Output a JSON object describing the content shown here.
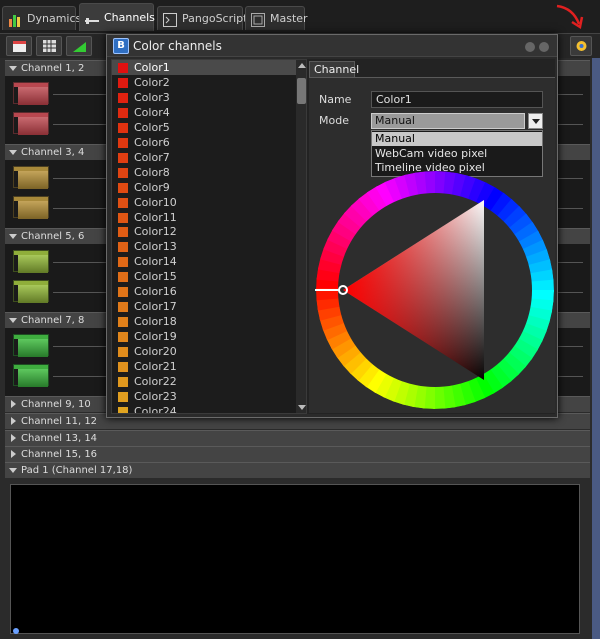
{
  "tabs": [
    {
      "label": "Dynamics",
      "icon": "bar-chart-icon"
    },
    {
      "label": "Channels",
      "icon": "channels-icon"
    },
    {
      "label": "PangoScript",
      "icon": "script-icon"
    },
    {
      "label": "Master",
      "icon": "master-icon"
    }
  ],
  "toolbar": {
    "buttons": [
      "calendar-icon",
      "table-icon",
      "ramp-icon"
    ],
    "settings_icon": "flower-settings-icon"
  },
  "channel_groups": [
    {
      "label": "Channel 1, 2",
      "expanded": true,
      "color": "#b8474f"
    },
    {
      "label": "Channel 3, 4",
      "expanded": true,
      "color": "#a8893a"
    },
    {
      "label": "Channel 5, 6",
      "expanded": true,
      "color": "#8fae3a"
    },
    {
      "label": "Channel 7, 8",
      "expanded": true,
      "color": "#3fae3f"
    },
    {
      "label": "Channel 9, 10",
      "expanded": false
    },
    {
      "label": "Channel 11, 12",
      "expanded": false
    },
    {
      "label": "Channel 13, 14",
      "expanded": false
    },
    {
      "label": "Channel 15, 16",
      "expanded": false
    }
  ],
  "pad": {
    "label": "Pad 1 (Channel 17,18)"
  },
  "dialog": {
    "title": "Color channels",
    "colors": [
      {
        "name": "Color1",
        "swatch": "#e01010"
      },
      {
        "name": "Color2",
        "swatch": "#e01a10"
      },
      {
        "name": "Color3",
        "swatch": "#e02210"
      },
      {
        "name": "Color4",
        "swatch": "#e02a10"
      },
      {
        "name": "Color5",
        "swatch": "#e03210"
      },
      {
        "name": "Color6",
        "swatch": "#e03810"
      },
      {
        "name": "Color7",
        "swatch": "#e03e12"
      },
      {
        "name": "Color8",
        "swatch": "#e04412"
      },
      {
        "name": "Color9",
        "swatch": "#e04a12"
      },
      {
        "name": "Color10",
        "swatch": "#e05014"
      },
      {
        "name": "Color11",
        "swatch": "#e05614"
      },
      {
        "name": "Color12",
        "swatch": "#e05c14"
      },
      {
        "name": "Color13",
        "swatch": "#e06216"
      },
      {
        "name": "Color14",
        "swatch": "#e06816"
      },
      {
        "name": "Color15",
        "swatch": "#e06e18"
      },
      {
        "name": "Color16",
        "swatch": "#e07418"
      },
      {
        "name": "Color17",
        "swatch": "#e07a1a"
      },
      {
        "name": "Color18",
        "swatch": "#e0801a"
      },
      {
        "name": "Color19",
        "swatch": "#e0861c"
      },
      {
        "name": "Color20",
        "swatch": "#e08c1c"
      },
      {
        "name": "Color21",
        "swatch": "#e0921e"
      },
      {
        "name": "Color22",
        "swatch": "#e0981e"
      },
      {
        "name": "Color23",
        "swatch": "#e09e20"
      },
      {
        "name": "Color24",
        "swatch": "#e0a420"
      }
    ],
    "selected_color_index": 0,
    "tab_label": "Channel",
    "name_label": "Name",
    "name_value": "Color1",
    "mode_label": "Mode",
    "mode_value": "Manual",
    "mode_options": [
      "Manual",
      "WebCam video pixel",
      "Timeline video pixel"
    ]
  }
}
